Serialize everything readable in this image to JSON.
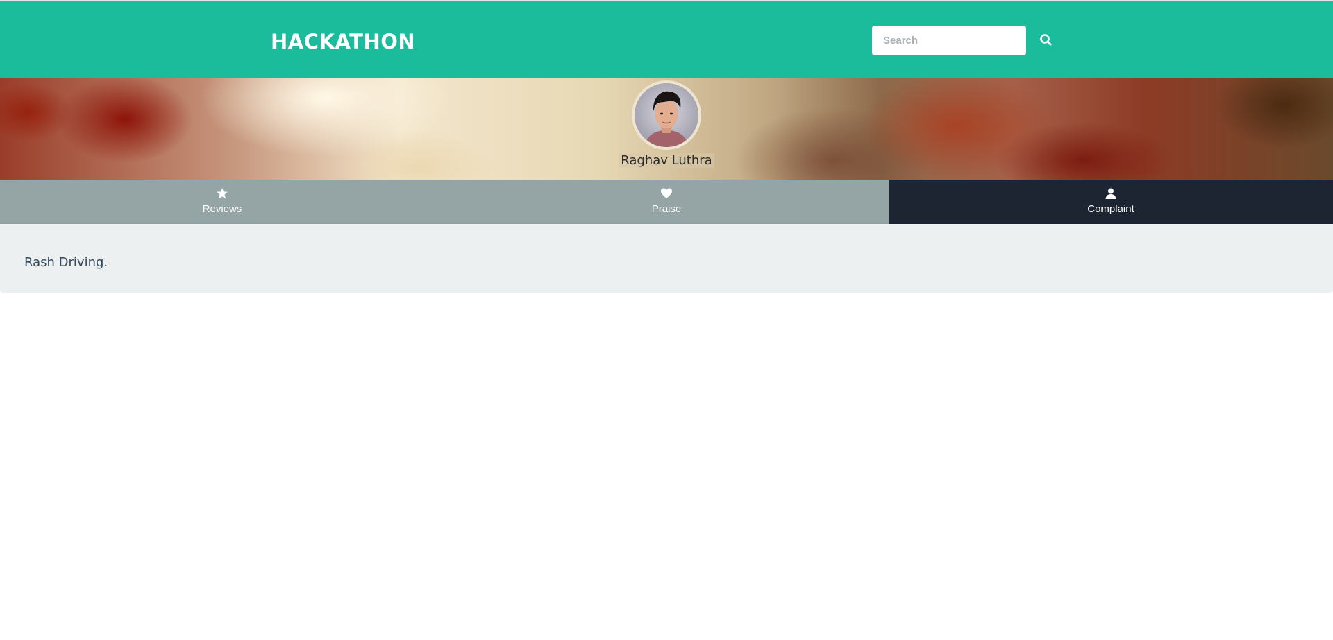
{
  "navbar": {
    "brand": "HACKATHON",
    "search_placeholder": "Search",
    "search_icon": "search-icon",
    "background_color": "#1abc9c"
  },
  "profile": {
    "name": "Raghav Luthra",
    "avatar_icon": "user-photo"
  },
  "tabs": [
    {
      "label": "Reviews",
      "icon": "star-icon",
      "active": false
    },
    {
      "label": "Praise",
      "icon": "heart-icon",
      "active": false
    },
    {
      "label": "Complaint",
      "icon": "user-icon",
      "active": true
    }
  ],
  "tab_colors": {
    "inactive": "#95a5a6",
    "active": "#1c2531"
  },
  "content": {
    "text": "Rash Driving."
  }
}
